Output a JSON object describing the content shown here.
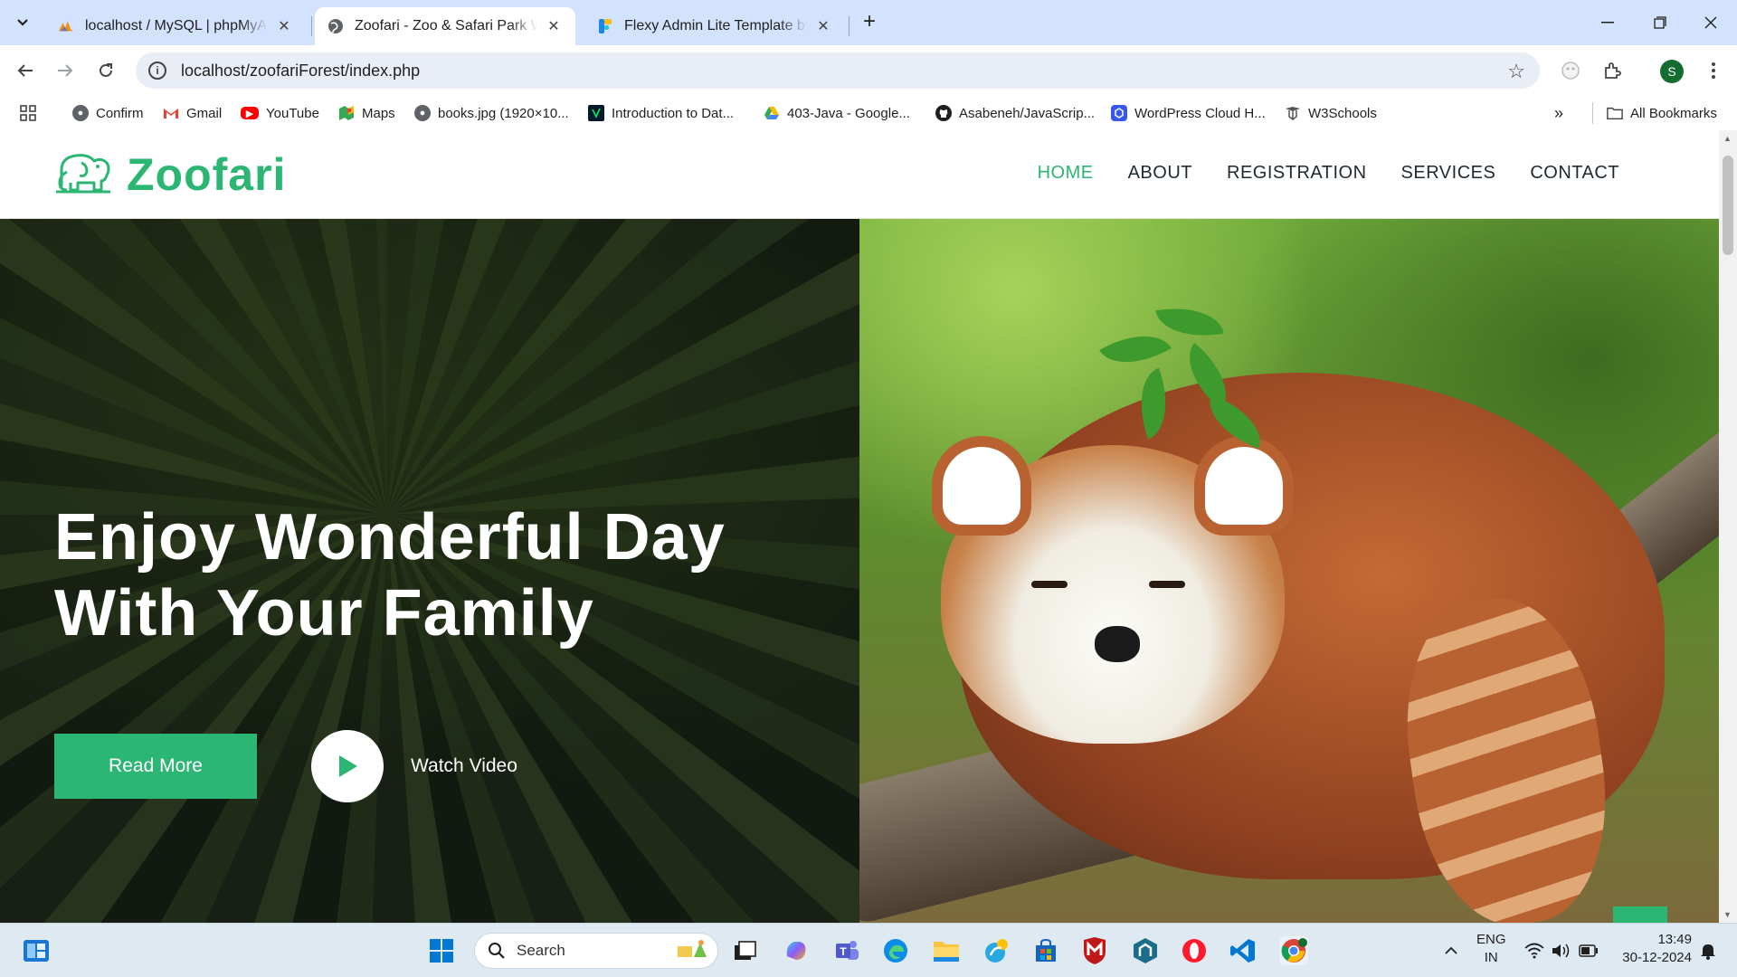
{
  "browser": {
    "tabs": [
      {
        "title": "localhost / MySQL | phpMyAdmin",
        "favicon": "phpmyadmin-icon",
        "active": false
      },
      {
        "title": "Zoofari - Zoo & Safari Park Website",
        "favicon": "globe-icon",
        "active": true
      },
      {
        "title": "Flexy Admin Lite Template by WrapPixel",
        "favicon": "flexy-icon",
        "active": false
      }
    ],
    "new_tab": "+",
    "address": "localhost/zoofariForest/index.php",
    "profile_initial": "S",
    "bookmarks": [
      {
        "label": "Confirm",
        "icon": "globe-icon"
      },
      {
        "label": "Gmail",
        "icon": "gmail-icon"
      },
      {
        "label": "YouTube",
        "icon": "youtube-icon"
      },
      {
        "label": "Maps",
        "icon": "maps-icon"
      },
      {
        "label": "books.jpg (1920×10...",
        "icon": "globe-icon"
      },
      {
        "label": "Introduction to Dat...",
        "icon": "datacamp-icon"
      },
      {
        "label": "403-Java - Google...",
        "icon": "drive-icon"
      },
      {
        "label": "Asabeneh/JavaScrip...",
        "icon": "github-icon"
      },
      {
        "label": "WordPress Cloud H...",
        "icon": "wordpress-icon"
      },
      {
        "label": "W3Schools",
        "icon": "w3schools-icon"
      }
    ],
    "more_bookmarks": "»",
    "all_bookmarks": "All Bookmarks"
  },
  "site": {
    "brand": "Zoofari",
    "brand_color": "#2bb673",
    "nav": [
      {
        "label": "HOME",
        "active": true
      },
      {
        "label": "ABOUT",
        "active": false
      },
      {
        "label": "REGISTRATION",
        "active": false
      },
      {
        "label": "SERVICES",
        "active": false
      },
      {
        "label": "CONTACT",
        "active": false
      }
    ],
    "hero": {
      "title_line1": "Enjoy Wonderful Day",
      "title_line2": "With Your Family",
      "read_more": "Read More",
      "watch_video": "Watch Video"
    },
    "back_to_top": "↑"
  },
  "taskbar": {
    "search_label": "Search",
    "language_line1": "ENG",
    "language_line2": "IN",
    "time": "13:49",
    "date": "30-12-2024"
  }
}
